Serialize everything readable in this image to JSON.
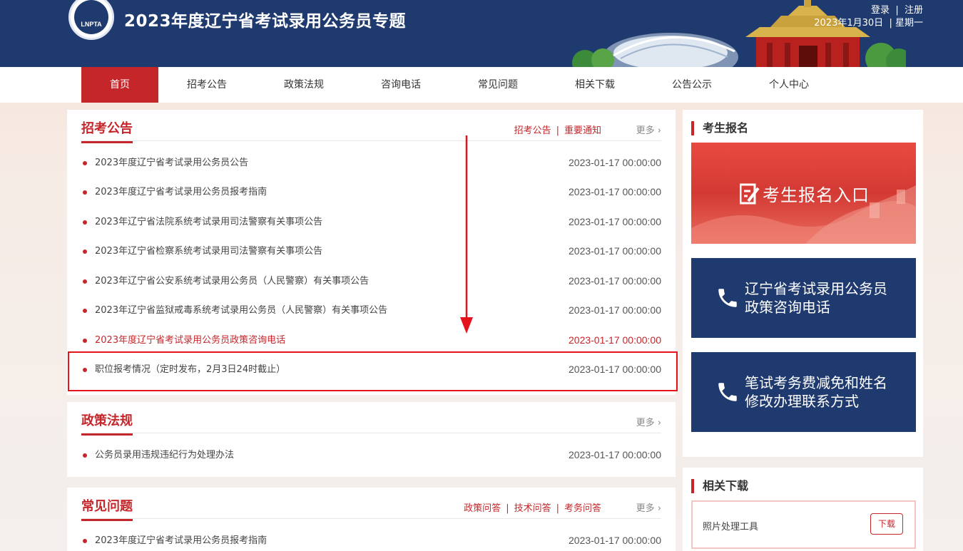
{
  "header": {
    "logo_text": "LNPTA",
    "title": "2023年度辽宁省考试录用公务员专题",
    "login": "登录",
    "register": "注册",
    "date": "2023年1月30日",
    "weekday": "星期一"
  },
  "nav": {
    "items": [
      {
        "label": "首页",
        "active": true
      },
      {
        "label": "招考公告"
      },
      {
        "label": "政策法规"
      },
      {
        "label": "咨询电话"
      },
      {
        "label": "常见问题"
      },
      {
        "label": "相关下载"
      },
      {
        "label": "公告公示"
      },
      {
        "label": "个人中心"
      }
    ]
  },
  "notices": {
    "title": "招考公告",
    "links": [
      "招考公告",
      "重要通知"
    ],
    "more": "更多 ›",
    "items": [
      {
        "title": "2023年度辽宁省考试录用公务员公告",
        "date": "2023-01-17 00:00:00"
      },
      {
        "title": "2023年度辽宁省考试录用公务员报考指南",
        "date": "2023-01-17 00:00:00"
      },
      {
        "title": "2023年辽宁省法院系统考试录用司法警察有关事项公告",
        "date": "2023-01-17 00:00:00"
      },
      {
        "title": "2023年辽宁省检察系统考试录用司法警察有关事项公告",
        "date": "2023-01-17 00:00:00"
      },
      {
        "title": "2023年辽宁省公安系统考试录用公务员（人民警察）有关事项公告",
        "date": "2023-01-17 00:00:00"
      },
      {
        "title": "2023年辽宁省监狱戒毒系统考试录用公务员（人民警察）有关事项公告",
        "date": "2023-01-17 00:00:00"
      },
      {
        "title": "2023年度辽宁省考试录用公务员政策咨询电话",
        "date": "2023-01-17 00:00:00"
      },
      {
        "title": "职位报考情况（定时发布，2月3日24时截止）",
        "date": "2023-01-17 00:00:00"
      }
    ]
  },
  "policy": {
    "title": "政策法规",
    "more": "更多 ›",
    "items": [
      {
        "title": "公务员录用违规违纪行为处理办法",
        "date": "2023-01-17 00:00:00"
      }
    ]
  },
  "faq": {
    "title": "常见问题",
    "links": [
      "政策问答",
      "技术问答",
      "考务问答"
    ],
    "more": "更多 ›",
    "items": [
      {
        "title": "2023年度辽宁省考试录用公务员报考指南",
        "date": "2023-01-17 00:00:00"
      }
    ]
  },
  "sidebar": {
    "register_title": "考生报名",
    "register_entry": "考生报名入口",
    "card1_line1": "辽宁省考试录用公务员",
    "card1_line2": "政策咨询电话",
    "card2_line1": "笔试考务费减免和姓名",
    "card2_line2": "修改办理联系方式",
    "download_title": "相关下载",
    "download_item": "照片处理工具",
    "download_button": "下载"
  },
  "colors": {
    "brand_blue": "#1f3a6e",
    "brand_red": "#c5262a",
    "highlight_red": "#e5141c"
  }
}
